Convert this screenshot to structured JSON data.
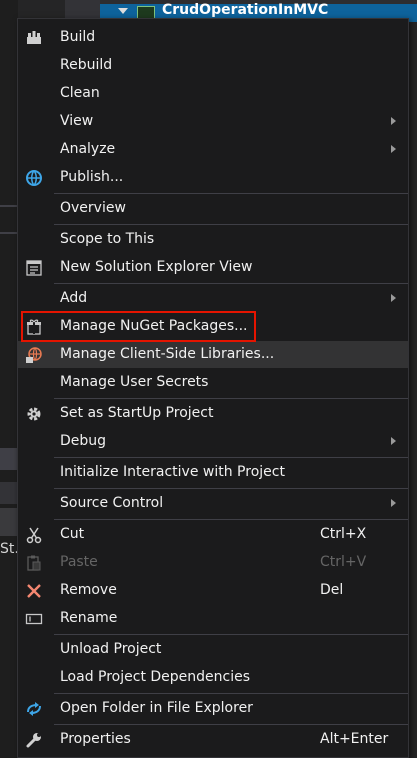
{
  "background": {
    "project_name": "CrudOperationInMVC",
    "left_edge_text": "St."
  },
  "colors": {
    "menu_bg": "#1b1b1c",
    "hover_bg": "#333334",
    "highlight": "#e51400",
    "text": "#f1f1f1",
    "disabled_text": "#656565"
  },
  "menu": {
    "items": [
      {
        "label": "Build",
        "icon": "build-icon"
      },
      {
        "label": "Rebuild"
      },
      {
        "label": "Clean"
      },
      {
        "label": "View",
        "submenu": true
      },
      {
        "label": "Analyze",
        "submenu": true
      },
      {
        "label": "Publish...",
        "icon": "globe-icon"
      },
      {
        "label": "Overview"
      },
      {
        "label": "Scope to This"
      },
      {
        "label": "New Solution Explorer View",
        "icon": "solution-explorer-icon"
      },
      {
        "label": "Add",
        "submenu": true
      },
      {
        "label": "Manage NuGet Packages...",
        "icon": "nuget-package-icon",
        "highlighted": true
      },
      {
        "label": "Manage Client-Side Libraries...",
        "icon": "client-libraries-icon",
        "hover": true
      },
      {
        "label": "Manage User Secrets"
      },
      {
        "label": "Set as StartUp Project",
        "icon": "gear-icon"
      },
      {
        "label": "Debug",
        "submenu": true
      },
      {
        "label": "Initialize Interactive with Project"
      },
      {
        "label": "Source Control",
        "submenu": true
      },
      {
        "label": "Cut",
        "icon": "scissors-icon",
        "shortcut": "Ctrl+X"
      },
      {
        "label": "Paste",
        "icon": "paste-icon",
        "shortcut": "Ctrl+V",
        "disabled": true
      },
      {
        "label": "Remove",
        "icon": "remove-x-icon",
        "shortcut": "Del"
      },
      {
        "label": "Rename",
        "icon": "rename-icon"
      },
      {
        "label": "Unload Project"
      },
      {
        "label": "Load Project Dependencies"
      },
      {
        "label": "Open Folder in File Explorer",
        "icon": "refresh-arrow-icon"
      },
      {
        "label": "Properties",
        "icon": "wrench-icon",
        "shortcut": "Alt+Enter"
      }
    ]
  }
}
